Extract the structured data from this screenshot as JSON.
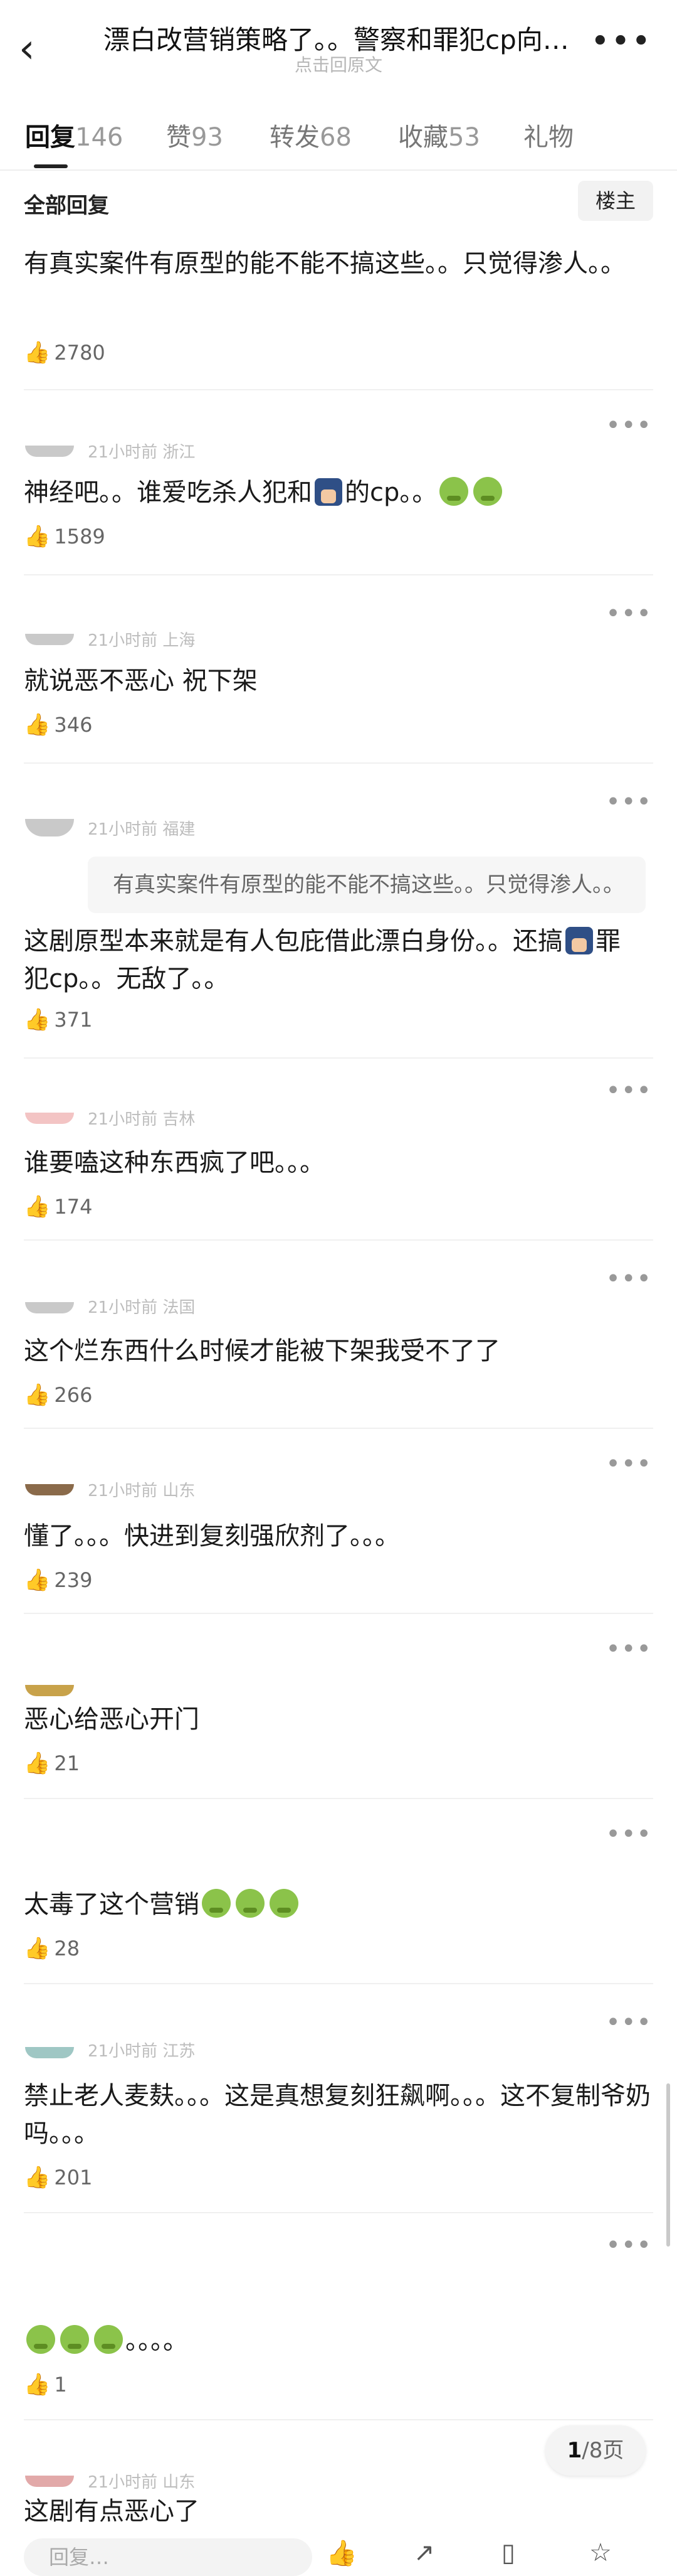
{
  "header": {
    "back_icon": "back-arrow-icon",
    "title": "漂白改营销策略了。。警察和罪犯cp向。…",
    "subtitle": "点击回原文",
    "more_icon": "more-icon"
  },
  "tabs": [
    {
      "label": "回复",
      "count": "146"
    },
    {
      "label": "赞",
      "count": "93"
    },
    {
      "label": "转发",
      "count": "68"
    },
    {
      "label": "收藏",
      "count": "53"
    },
    {
      "label": "礼物",
      "count": ""
    }
  ],
  "section": {
    "title": "全部回复",
    "owner_button": "楼主"
  },
  "comments": [
    {
      "meta": "",
      "text": "有真实案件有原型的能不能不搞这些。。只觉得渗人。。",
      "likes": "2780"
    },
    {
      "meta": "21小时前 浙江",
      "text_a": "神经吧。。谁爱吃杀人犯和",
      "text_b": "的cp。。",
      "likes": "1589"
    },
    {
      "meta": "21小时前 上海",
      "text": "就说恶不恶心 祝下架",
      "likes": "346"
    },
    {
      "meta": "21小时前 福建",
      "quote": "有真实案件有原型的能不能不搞这些。。只觉得渗人。。",
      "text_a": "这剧原型本来就是有人包庇借此漂白身份。。还搞",
      "text_b": "罪犯cp。。无敌了。。",
      "likes": "371"
    },
    {
      "meta": "21小时前 吉林",
      "text": "谁要嗑这种东西疯了吧。。。",
      "likes": "174"
    },
    {
      "meta": "21小时前 法国",
      "text": "这个烂东西什么时候才能被下架我受不了了",
      "likes": "266"
    },
    {
      "meta": "21小时前 山东",
      "text": "懂了。。。快进到复刻强欣剂了。。。",
      "likes": "239"
    },
    {
      "meta": "",
      "text": "恶心给恶心开门",
      "likes": "21"
    },
    {
      "meta": "",
      "text": "太毒了这个营销",
      "likes": "28"
    },
    {
      "meta": "21小时前 江苏",
      "text": "禁止老人麦麸。。。这是真想复刻狂飙啊。。。这不复制爷奶吗。。。",
      "likes": "201"
    },
    {
      "meta": "",
      "text": "。。。。",
      "likes": "1"
    },
    {
      "meta": "21小时前 山东",
      "text": "这剧有点恶心了",
      "likes": ""
    }
  ],
  "pager": {
    "current": "1",
    "total": "/8页"
  },
  "bottom": {
    "reply_placeholder": "回复…"
  }
}
